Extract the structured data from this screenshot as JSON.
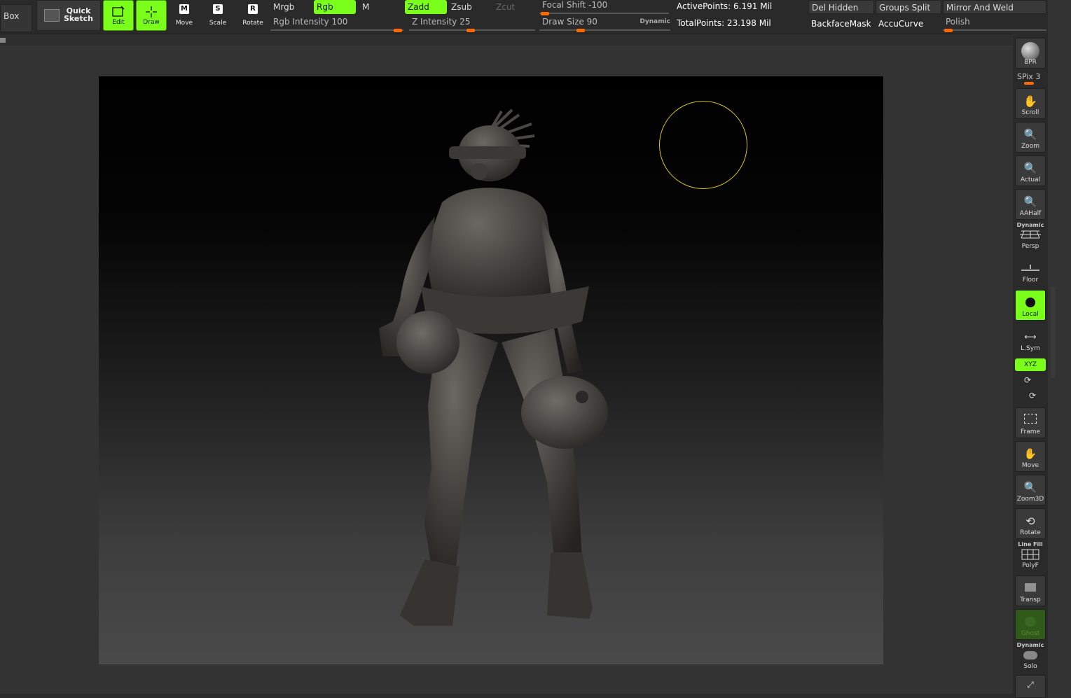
{
  "toolbar": {
    "box_label": "Box",
    "quick_sketch_label": "Quick Sketch",
    "edit_label": "Edit",
    "draw_label": "Draw",
    "move_label": "Move",
    "move_key": "M",
    "scale_label": "Scale",
    "scale_key": "S",
    "rotate_label": "Rotate",
    "rotate_key": "R",
    "mrgb": "Mrgb",
    "rgb": "Rgb",
    "m": "M",
    "zadd": "Zadd",
    "zsub": "Zsub",
    "zcut": "Zcut",
    "rgb_intensity_label": "Rgb Intensity",
    "rgb_intensity_value": "100",
    "z_intensity_label": "Z Intensity",
    "z_intensity_value": "25",
    "focal_shift_label": "Focal Shift",
    "focal_shift_value": "-100",
    "draw_size_label": "Draw Size",
    "draw_size_value": "90",
    "dynamic_label": "Dynamic",
    "active_points": "ActivePoints: 6.191 Mil",
    "total_points": "TotalPoints: 23.198 Mil",
    "del_hidden": "Del Hidden",
    "groups_split": "Groups Split",
    "mirror_and_weld": "Mirror And Weld",
    "backface_mask": "BackfaceMask",
    "accucurve": "AccuCurve",
    "polish": "Polish"
  },
  "shelf": {
    "bpr": "BPR",
    "spix": "SPix 3",
    "scroll": "Scroll",
    "zoom": "Zoom",
    "actual": "Actual",
    "aahalf": "AAHalf",
    "persp_top": "Dynamic",
    "persp": "Persp",
    "floor": "Floor",
    "local": "Local",
    "lsym": "L.Sym",
    "xyz": "XYZ",
    "frame": "Frame",
    "move": "Move",
    "zoom3d": "Zoom3D",
    "rotate": "Rotate",
    "polyf_top": "Line Fill",
    "polyf": "PolyF",
    "transp": "Transp",
    "ghost": "Ghost",
    "solo_top": "Dynamic",
    "solo": "Solo"
  },
  "colors": {
    "accent_green": "#7aff1a",
    "slider_orange": "#ff6a00",
    "brush_ring": "#d8c41a"
  }
}
